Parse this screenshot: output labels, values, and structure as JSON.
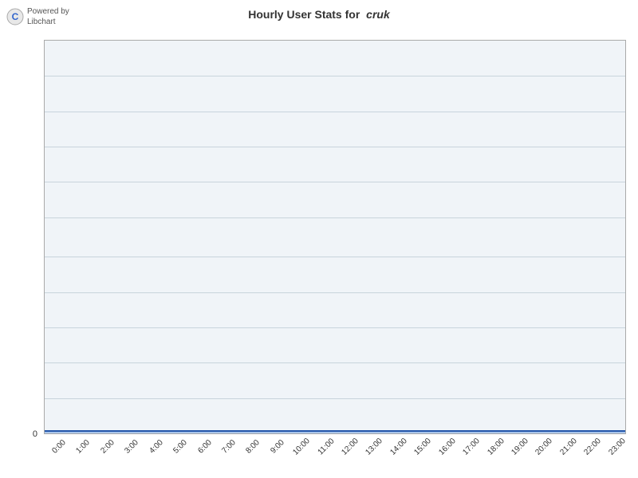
{
  "app": {
    "powered_by": "Powered by\nLibchart",
    "logo_text": "C"
  },
  "chart": {
    "title": "Hourly User Stats for cruk",
    "title_prefix": "Hourly User Stats for",
    "title_subject": "cruk",
    "y_axis": {
      "labels": [
        "0"
      ]
    },
    "x_axis": {
      "labels": [
        "0:00",
        "1:00",
        "2:00",
        "3:00",
        "4:00",
        "5:00",
        "6:00",
        "7:00",
        "8:00",
        "9:00",
        "10:00",
        "11:00",
        "12:00",
        "13:00",
        "14:00",
        "15:00",
        "16:00",
        "17:00",
        "18:00",
        "19:00",
        "20:00",
        "21:00",
        "22:00",
        "23:00"
      ]
    },
    "grid_line_count": 10,
    "colors": {
      "background": "#f0f4f8",
      "grid_line": "#c8d4dc",
      "data_line": "#2255aa",
      "data_fill": "rgba(100,150,220,0.5)"
    }
  }
}
